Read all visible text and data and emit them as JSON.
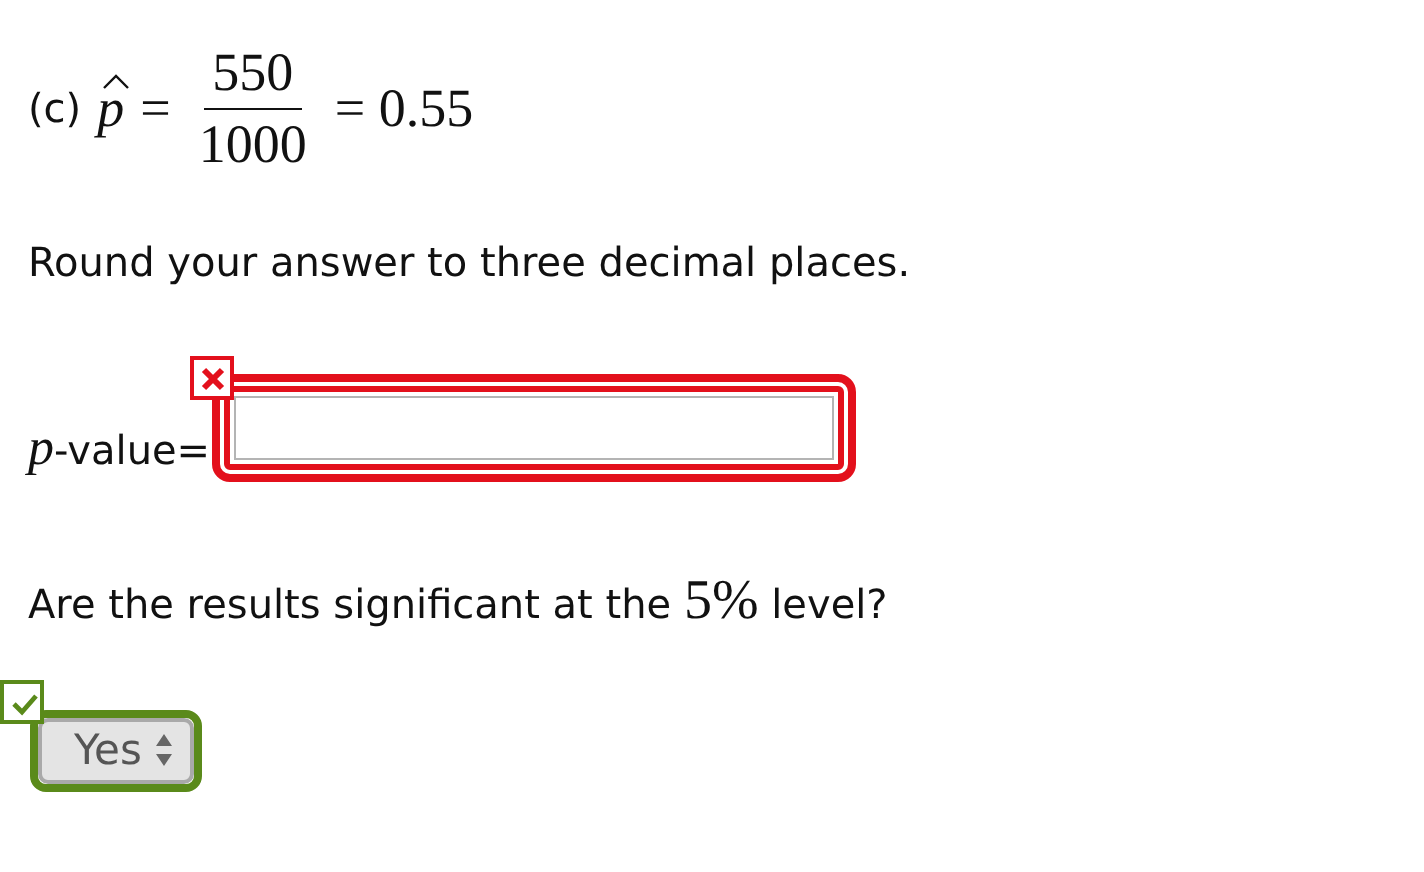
{
  "part_label": "(c)",
  "estimate": {
    "symbol": "p",
    "equals": "=",
    "numerator": "550",
    "denominator": "1000",
    "result": "= 0.55"
  },
  "instruction": "Round your answer to three decimal places.",
  "answer": {
    "symbol": "p",
    "label": "-value=",
    "correct": false
  },
  "question": {
    "before": "Are the results significant at the",
    "math": "5%",
    "after": "level?"
  },
  "choice": {
    "value": "Yes",
    "correct": true
  }
}
